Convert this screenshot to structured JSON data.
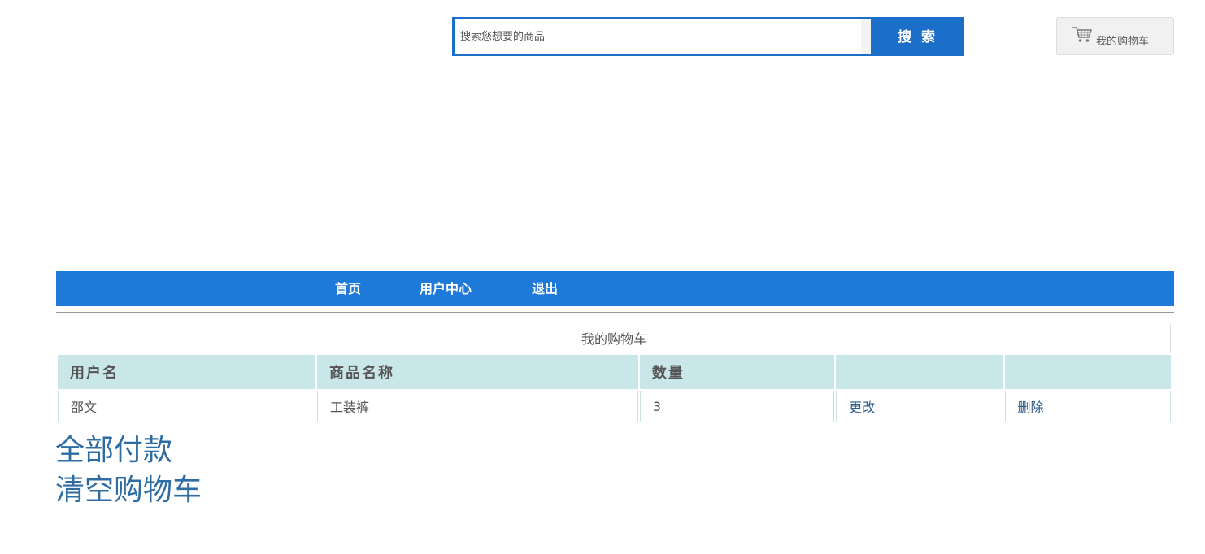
{
  "search": {
    "placeholder": "搜索您想要的商品",
    "button_label": "搜 索"
  },
  "cart_button": {
    "icon": "shopping-cart-icon",
    "label": "我的购物车"
  },
  "nav": {
    "items": [
      {
        "label": "首页"
      },
      {
        "label": "用户中心"
      },
      {
        "label": "退出"
      }
    ]
  },
  "cart_table": {
    "caption": "我的购物车",
    "headers": [
      "用户名",
      "商品名称",
      "数量",
      "",
      ""
    ],
    "rows": [
      {
        "username": "邵文",
        "product": "工装裤",
        "quantity": "3",
        "edit": "更改",
        "delete": "删除"
      }
    ]
  },
  "actions": {
    "pay_all": "全部付款",
    "clear_cart": "清空购物车"
  },
  "colors": {
    "primary_blue": "#1c6fc9",
    "nav_blue": "#1e7ad9",
    "table_header_bg": "#c9e7e9",
    "link_blue": "#2e6da4"
  }
}
